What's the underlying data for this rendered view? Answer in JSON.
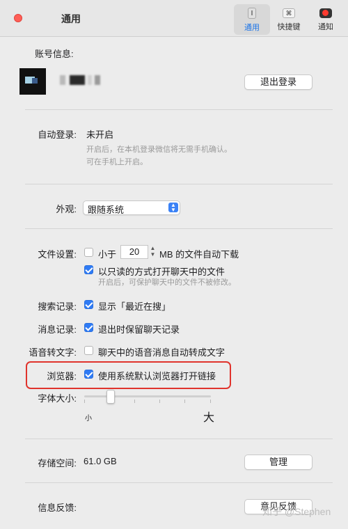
{
  "window": {
    "title": "通用"
  },
  "toolbar": {
    "items": [
      {
        "label": "通用",
        "icon": "general-icon",
        "active": true
      },
      {
        "label": "快捷键",
        "icon": "shortcut-icon",
        "glyph": "⌘"
      },
      {
        "label": "通知",
        "icon": "notification-icon"
      }
    ]
  },
  "account": {
    "label": "账号信息:",
    "logout_button": "退出登录"
  },
  "auto_login": {
    "label": "自动登录:",
    "value": "未开启",
    "hint_line1": "开启后，在本机登录微信将无需手机确认。",
    "hint_line2": "可在手机上开启。"
  },
  "appearance": {
    "label": "外观:",
    "selected": "跟随系统"
  },
  "files": {
    "label": "文件设置:",
    "auto_download_prefix": "小于",
    "auto_download_size": "20",
    "auto_download_suffix": "MB 的文件自动下载",
    "readonly_label": "以只读的方式打开聊天中的文件",
    "readonly_hint": "开启后，可保护聊天中的文件不被修改。"
  },
  "search_history": {
    "label": "搜索记录:",
    "option": "显示「最近在搜」"
  },
  "message_history": {
    "label": "消息记录:",
    "option": "退出时保留聊天记录"
  },
  "voice_to_text": {
    "label": "语音转文字:",
    "option": "聊天中的语音消息自动转成文字"
  },
  "browser": {
    "label": "浏览器:",
    "option": "使用系统默认浏览器打开链接"
  },
  "font_size": {
    "label": "字体大小:",
    "small": "小",
    "large": "大",
    "level": 0.2
  },
  "storage": {
    "label": "存储空间:",
    "value": "61.0 GB",
    "manage_button": "管理"
  },
  "feedback": {
    "label": "信息反馈:",
    "button": "意见反馈"
  },
  "watermark": "知乎 @Stephen",
  "colors": {
    "accent": "#2f7bf5",
    "highlight": "#e0332c",
    "close": "#ff5f57"
  }
}
